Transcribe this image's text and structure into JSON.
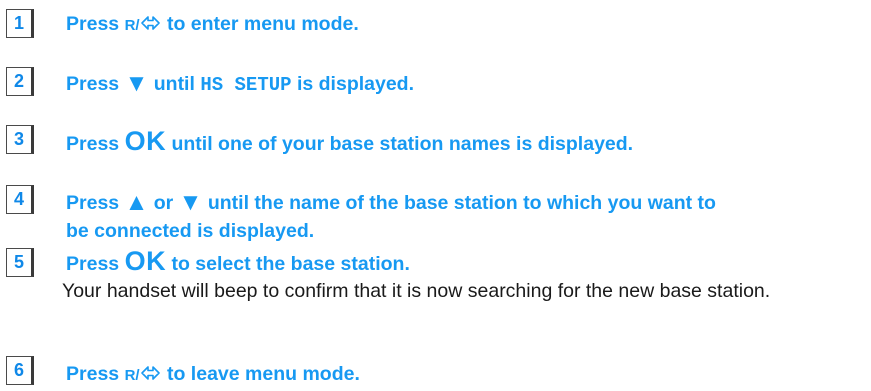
{
  "steps": [
    {
      "number": "1",
      "pre": "Press ",
      "key": "R/",
      "post": " to enter menu mode."
    },
    {
      "number": "2",
      "pre": "Press ",
      "arrow": "▼",
      "mid": " until ",
      "mono": "HS SETUP",
      "post": " is displayed."
    },
    {
      "number": "3",
      "pre": "Press ",
      "key": "OK",
      "post": " until one of your base station names is displayed."
    },
    {
      "number": "4",
      "pre": "Press ",
      "arrow_up": "▲",
      "or": " or ",
      "arrow_down": "▼",
      "post": " until the name of the base station to which you want to",
      "line2": "be connected is displayed."
    },
    {
      "number": "5",
      "pre": "Press ",
      "key": "OK",
      "post": " to select the base station.",
      "body": "Your handset will beep to confirm that it is now searching for the new base station."
    },
    {
      "number": "6",
      "pre": "Press ",
      "key": "R/",
      "post": " to leave menu mode."
    }
  ],
  "icons": {
    "recall_arrow": "recall-arrow-icon"
  },
  "colors": {
    "instruction": "#1799f2",
    "badge_number": "#0f88e8",
    "body": "#1a1a1a"
  }
}
